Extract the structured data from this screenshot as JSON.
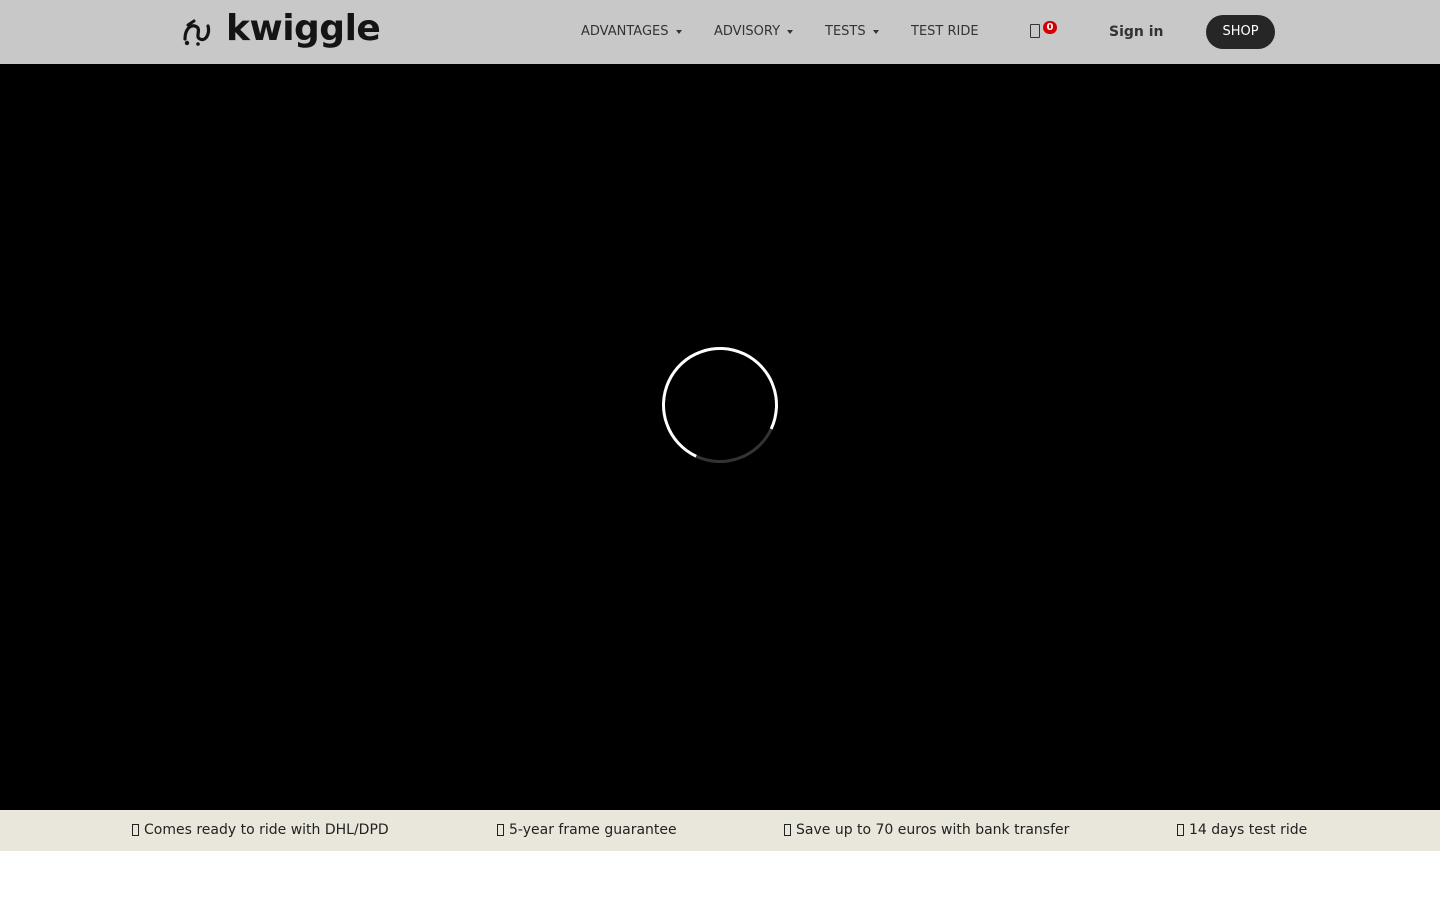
{
  "brand": {
    "name": "kwiggle",
    "logo_icon": "kwiggle-bike-icon"
  },
  "nav": {
    "items": [
      {
        "label": "ADVANTAGES",
        "has_dropdown": true
      },
      {
        "label": "ADVISORY",
        "has_dropdown": true
      },
      {
        "label": "TESTS",
        "has_dropdown": true
      },
      {
        "label": "TEST RIDE",
        "has_dropdown": false
      }
    ],
    "cart": {
      "icon": "cart-icon",
      "count": "0",
      "badge_color": "#d40000"
    },
    "signin_label": "Sign in",
    "shop_label": "SHOP"
  },
  "hero": {
    "state": "loading",
    "spinner_icon": "loading-spinner-icon"
  },
  "usp": {
    "items": [
      {
        "icon": "truck-icon",
        "text": "Comes ready to ride with DHL/DPD"
      },
      {
        "icon": "shield-icon",
        "text": "5-year frame guarantee"
      },
      {
        "icon": "euro-icon",
        "text": "Save up to 70 euros with bank transfer"
      },
      {
        "icon": "bike-icon",
        "text": "14 days test ride"
      }
    ]
  },
  "colors": {
    "navbar_bg": "#c8c8c8",
    "hero_bg": "#000000",
    "usp_bg": "#e9e6dc",
    "shop_button_bg": "#262626"
  }
}
